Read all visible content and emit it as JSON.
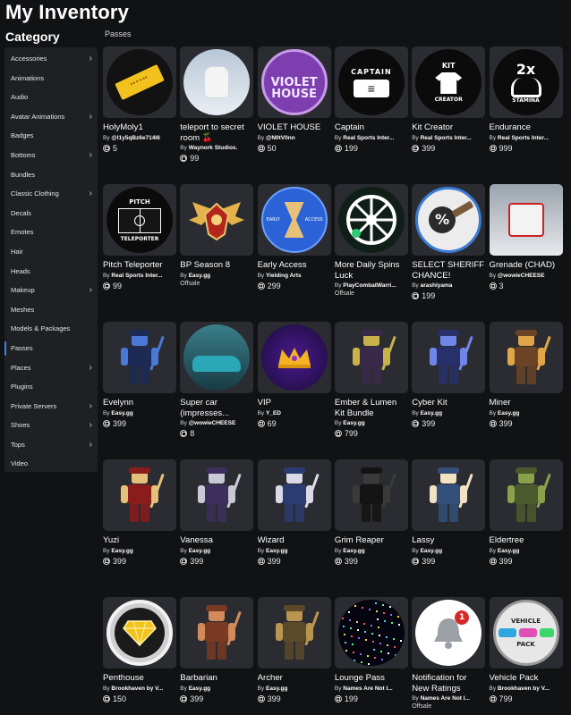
{
  "page": {
    "title": "My Inventory",
    "category_heading": "Category",
    "section": "Passes"
  },
  "sidebar": [
    {
      "label": "Accessories",
      "chevron": true
    },
    {
      "label": "Animations",
      "chevron": false
    },
    {
      "label": "Audio",
      "chevron": false
    },
    {
      "label": "Avatar Animations",
      "chevron": true
    },
    {
      "label": "Badges",
      "chevron": false
    },
    {
      "label": "Bottoms",
      "chevron": true
    },
    {
      "label": "Bundles",
      "chevron": false
    },
    {
      "label": "Classic Clothing",
      "chevron": true
    },
    {
      "label": "Decals",
      "chevron": false
    },
    {
      "label": "Emotes",
      "chevron": false
    },
    {
      "label": "Hair",
      "chevron": false
    },
    {
      "label": "Heads",
      "chevron": false
    },
    {
      "label": "Makeup",
      "chevron": true
    },
    {
      "label": "Meshes",
      "chevron": false
    },
    {
      "label": "Models & Packages",
      "chevron": false
    },
    {
      "label": "Passes",
      "chevron": false,
      "active": true
    },
    {
      "label": "Places",
      "chevron": true
    },
    {
      "label": "Plugins",
      "chevron": false
    },
    {
      "label": "Private Servers",
      "chevron": true
    },
    {
      "label": "Shoes",
      "chevron": true
    },
    {
      "label": "Tops",
      "chevron": true
    },
    {
      "label": "Video",
      "chevron": false
    }
  ],
  "items": [
    {
      "name": "HolyMoly1",
      "creator": "@l1y5qBz6e714I6",
      "price": "5",
      "art": "ticket"
    },
    {
      "name": "teleport to secret room 🍒",
      "creator": "Waynork Studios.",
      "price": "99",
      "art": "snow"
    },
    {
      "name": "VIOLET HOUSE",
      "creator": "@N0tV0nn",
      "price": "50",
      "art": "violet",
      "art_text": "VIOLET HOUSE"
    },
    {
      "name": "Captain",
      "creator": "Real Sports Inter...",
      "price": "199",
      "art": "captain",
      "art_text": "CAPTAIN"
    },
    {
      "name": "Kit Creator",
      "creator": "Real Sports Inter...",
      "price": "399",
      "art": "kit",
      "art_text": "KIT",
      "art_text2": "CREATOR"
    },
    {
      "name": "Endurance",
      "creator": "Real Sports Inter...",
      "price": "999",
      "art": "stamina",
      "art_text": "2x",
      "art_text2": "STAMINA"
    },
    {
      "name": "Pitch Teleporter",
      "creator": "Real Sports Inter...",
      "price": "99",
      "art": "pitch",
      "art_text": "PITCH",
      "art_text2": "TELEPORTER"
    },
    {
      "name": "BP Season 8",
      "creator": "Easy.gg",
      "offsale": "Offsale",
      "art": "wings"
    },
    {
      "name": "Early Access",
      "creator": "Yielding Arts",
      "price": "299",
      "art": "early",
      "art_text": "EARLY",
      "art_text2": "ACCESS"
    },
    {
      "name": "More Daily Spins Luck",
      "creator": "PlayCombatWarri...",
      "offsale": "Offsale",
      "art": "wheel"
    },
    {
      "name": "SELECT SHERIFF CHANCE!",
      "creator": "arashiyama",
      "price": "199",
      "art": "sheriff",
      "art_text": "%"
    },
    {
      "name": "Grenade (CHAD)",
      "creator": "@wowieCHEESE",
      "price": "3",
      "art": "grenade"
    },
    {
      "name": "Evelynn",
      "creator": "Easy.gg",
      "price": "399",
      "art": "char",
      "color": "#1d2a55",
      "accent": "#4a78d6"
    },
    {
      "name": "Super car (impresses...",
      "creator": "@wowieCHEESE",
      "price": "8",
      "art": "car"
    },
    {
      "name": "VIP",
      "creator": "Y_ED",
      "price": "69",
      "art": "vip"
    },
    {
      "name": "Ember & Lumen Kit Bundle",
      "creator": "Easy.gg",
      "price": "799",
      "art": "char",
      "color": "#3a2a4a",
      "accent": "#c9b14a"
    },
    {
      "name": "Cyber Kit",
      "creator": "Easy.gg",
      "price": "399",
      "art": "char",
      "color": "#28306a",
      "accent": "#6f86e8"
    },
    {
      "name": "Miner",
      "creator": "Easy.gg",
      "price": "399",
      "art": "char",
      "color": "#6a4424",
      "accent": "#e0a548"
    },
    {
      "name": "Yuzi",
      "creator": "Easy.gg",
      "price": "399",
      "art": "char",
      "color": "#8b1c1c",
      "accent": "#e5c07b"
    },
    {
      "name": "Vanessa",
      "creator": "Easy.gg",
      "price": "399",
      "art": "char",
      "color": "#3c2f5c",
      "accent": "#c9c9d6"
    },
    {
      "name": "Wizard",
      "creator": "Easy.gg",
      "price": "399",
      "art": "char",
      "color": "#2b3c73",
      "accent": "#d9d9e8"
    },
    {
      "name": "Grim Reaper",
      "creator": "Easy.gg",
      "price": "399",
      "art": "char",
      "color": "#141414",
      "accent": "#3a3a3a"
    },
    {
      "name": "Lassy",
      "creator": "Easy.gg",
      "price": "399",
      "art": "char",
      "color": "#33507a",
      "accent": "#f1e2c4"
    },
    {
      "name": "Eldertree",
      "creator": "Easy.gg",
      "price": "399",
      "art": "char",
      "color": "#4b5a2d",
      "accent": "#8aa149"
    },
    {
      "name": "Penthouse",
      "creator": "Brookhaven by V...",
      "price": "150",
      "art": "diamond"
    },
    {
      "name": "Barbarian",
      "creator": "Easy.gg",
      "price": "399",
      "art": "char",
      "color": "#7a3a22",
      "accent": "#d28a5a"
    },
    {
      "name": "Archer",
      "creator": "Easy.gg",
      "price": "399",
      "art": "char",
      "color": "#5a4a2a",
      "accent": "#b9954f"
    },
    {
      "name": "Lounge Pass",
      "creator": "Names Are Not I...",
      "price": "199",
      "art": "lounge"
    },
    {
      "name": "Notification for New Ratings",
      "creator": "Names Are Not I...",
      "offsale": "Offsale",
      "art": "bell",
      "art_text": "1"
    },
    {
      "name": "Vehicle Pack",
      "creator": "Brookhaven by V...",
      "price": "799",
      "art": "vehicle",
      "art_text": "VEHICLE",
      "art_text2": "PACK"
    }
  ],
  "labels": {
    "by": "By"
  },
  "colors": {
    "background": "#111214",
    "card": "#2a2c31",
    "sidebar": "#1e2024",
    "active_indicator": "#3b82f6"
  }
}
